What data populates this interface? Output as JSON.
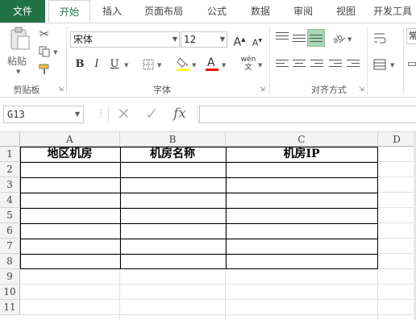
{
  "tabs": [
    {
      "label": "文件",
      "kind": "file"
    },
    {
      "label": "开始",
      "kind": "active"
    },
    {
      "label": "插入",
      "kind": "normal"
    },
    {
      "label": "页面布局",
      "kind": "normal"
    },
    {
      "label": "公式",
      "kind": "normal"
    },
    {
      "label": "数据",
      "kind": "normal"
    },
    {
      "label": "审阅",
      "kind": "normal"
    },
    {
      "label": "视图",
      "kind": "normal"
    },
    {
      "label": "开发工具",
      "kind": "normal"
    }
  ],
  "ribbon": {
    "clipboard": {
      "paste_label": "粘贴",
      "group_label": "剪贴板"
    },
    "font": {
      "font_name": "宋体",
      "font_size": "12",
      "group_label": "字体",
      "phonetic_label": "wén\n文",
      "bold": "B",
      "italic": "I",
      "underline": "U",
      "grow": "A",
      "shrink": "A"
    },
    "alignment": {
      "group_label": "对齐方式"
    },
    "number": {
      "format_label": "常"
    }
  },
  "formula_bar": {
    "name_box": "G13",
    "fx_label": "fx",
    "formula": ""
  },
  "columns": [
    "A",
    "B",
    "C",
    "D"
  ],
  "rows": [
    "1",
    "2",
    "3",
    "4",
    "5",
    "6",
    "7",
    "8",
    "9",
    "10",
    "11"
  ],
  "table_headers": [
    "地区机房",
    "机房名称",
    "机房IP"
  ],
  "colors": {
    "file_tab": "#217346",
    "highlight": "#ffff00",
    "font_color": "#ff0000",
    "align_active": "#a8d5b5"
  }
}
